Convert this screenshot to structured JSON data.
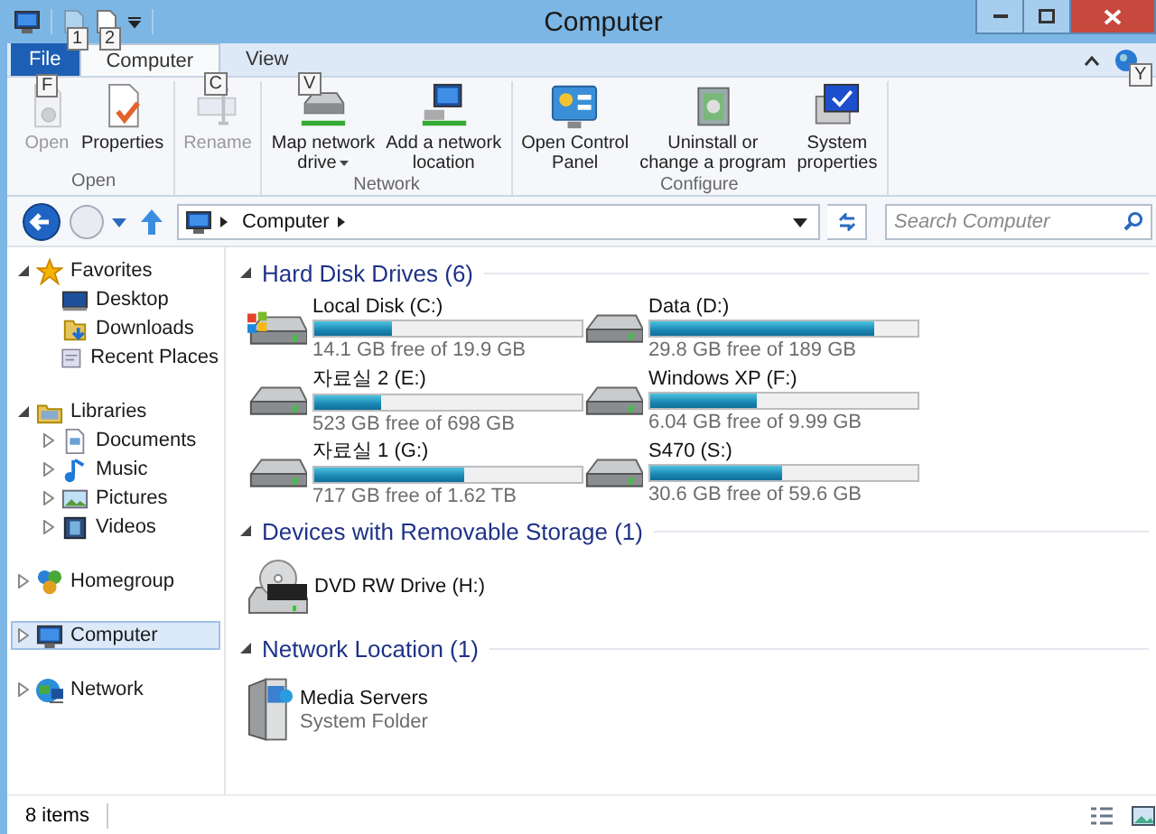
{
  "window": {
    "title": "Computer"
  },
  "quick_access": [
    {
      "keytip": "1",
      "disabled": true
    },
    {
      "keytip": "2",
      "disabled": false
    }
  ],
  "ribbon": {
    "tabs": [
      {
        "label": "File",
        "keytip": "F",
        "kind": "file",
        "selected": false
      },
      {
        "label": "Computer",
        "keytip": "C",
        "kind": "tab",
        "selected": true
      },
      {
        "label": "View",
        "keytip": "V",
        "kind": "tab",
        "selected": false
      }
    ],
    "help_keytip": "Y",
    "groups": [
      {
        "label": "Open",
        "buttons": [
          {
            "lines": [
              "Open"
            ],
            "kind": "open",
            "disabled": true
          },
          {
            "lines": [
              "Properties"
            ],
            "kind": "properties",
            "disabled": false
          }
        ]
      },
      {
        "buttons": [
          {
            "lines": [
              "Rename"
            ],
            "kind": "rename",
            "disabled": true
          }
        ]
      },
      {
        "label": "Network",
        "buttons": [
          {
            "lines": [
              "Map network",
              "drive"
            ],
            "kind": "map-drive",
            "disabled": false,
            "menu": true
          },
          {
            "lines": [
              "Add a network",
              "location"
            ],
            "kind": "network-location",
            "disabled": false
          }
        ]
      },
      {
        "label": "Configure",
        "buttons": [
          {
            "lines": [
              "Open Control",
              "Panel"
            ],
            "kind": "control-panel",
            "disabled": false
          },
          {
            "lines": [
              "Uninstall or",
              "change a program"
            ],
            "kind": "uninstall",
            "disabled": false
          },
          {
            "lines": [
              "System",
              "properties"
            ],
            "kind": "system",
            "disabled": false
          }
        ]
      }
    ]
  },
  "address": {
    "path": [
      "Computer"
    ],
    "search": {
      "placeholder": "Search Computer"
    }
  },
  "sidebar": {
    "items": [
      {
        "label": "Favorites",
        "kind": "star",
        "expanded": true,
        "selected": false,
        "children": [
          {
            "label": "Desktop",
            "kind": "desktop",
            "selected": false
          },
          {
            "label": "Downloads",
            "kind": "downloads",
            "selected": false
          },
          {
            "label": "Recent Places",
            "kind": "recent",
            "selected": false
          }
        ]
      },
      {
        "label": "Libraries",
        "kind": "library",
        "expanded": true,
        "selected": false,
        "children": [
          {
            "label": "Documents",
            "kind": "documents",
            "expanded": false,
            "selected": false
          },
          {
            "label": "Music",
            "kind": "music",
            "expanded": false,
            "selected": false
          },
          {
            "label": "Pictures",
            "kind": "pictures",
            "expanded": false,
            "selected": false
          },
          {
            "label": "Videos",
            "kind": "videos",
            "expanded": false,
            "selected": false
          }
        ]
      },
      {
        "label": "Homegroup",
        "kind": "homegroup",
        "expanded": false,
        "selected": false
      },
      {
        "label": "Computer",
        "kind": "computer",
        "expanded": false,
        "selected": true
      },
      {
        "label": "Network",
        "kind": "network",
        "expanded": false,
        "selected": false
      }
    ]
  },
  "sections": [
    {
      "title": "Hard Disk Drives (6)",
      "expanded": true,
      "items": [
        {
          "kind": "system-drive",
          "name": "Local Disk (C:)",
          "level": 0.29,
          "detail": "14.1 GB free of 19.9 GB"
        },
        {
          "kind": "drive",
          "name": "Data (D:)",
          "level": 0.84,
          "detail": "29.8 GB free of 189 GB"
        },
        {
          "kind": "drive",
          "name": "자료실 2 (E:)",
          "level": 0.25,
          "detail": "523 GB free of 698 GB"
        },
        {
          "kind": "drive",
          "name": "Windows XP (F:)",
          "level": 0.4,
          "detail": "6.04 GB free of 9.99 GB"
        },
        {
          "kind": "drive",
          "name": "자료실 1 (G:)",
          "level": 0.56,
          "detail": "717 GB free of 1.62 TB"
        },
        {
          "kind": "drive",
          "name": "S470 (S:)",
          "level": 0.49,
          "detail": "30.6 GB free of 59.6 GB"
        }
      ]
    },
    {
      "title": "Devices with Removable Storage (1)",
      "expanded": true,
      "items": [
        {
          "kind": "optical",
          "name": "DVD RW Drive (H:)"
        }
      ]
    },
    {
      "title": "Network Location (1)",
      "expanded": true,
      "items": [
        {
          "kind": "media-server",
          "name": "Media Servers",
          "detail": "System Folder"
        }
      ]
    }
  ],
  "status_bar": {
    "count": "8 items"
  }
}
